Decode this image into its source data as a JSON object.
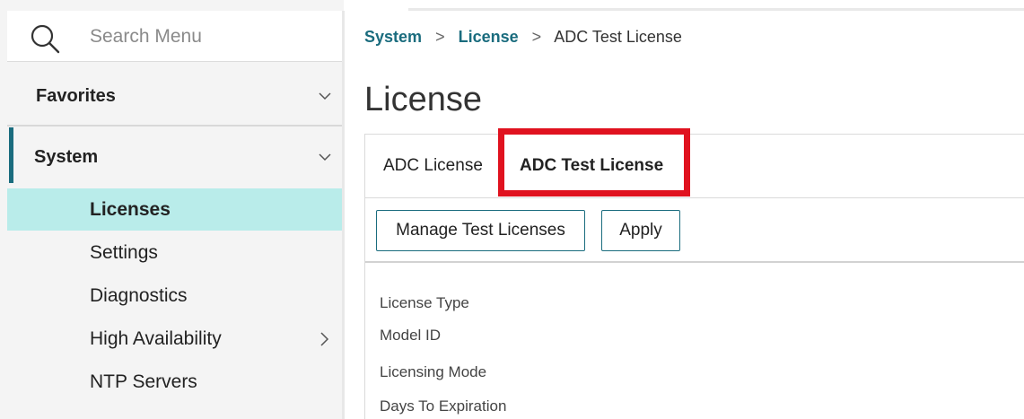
{
  "search": {
    "placeholder": "Search Menu"
  },
  "sidebar": {
    "favorites_label": "Favorites",
    "system_label": "System",
    "items": [
      {
        "label": "Licenses",
        "active": true
      },
      {
        "label": "Settings"
      },
      {
        "label": "Diagnostics"
      },
      {
        "label": "High Availability",
        "has_submenu": true
      },
      {
        "label": "NTP Servers"
      }
    ]
  },
  "breadcrumb": {
    "items": [
      "System",
      "License",
      "ADC Test License"
    ]
  },
  "page": {
    "title": "License"
  },
  "tabs": [
    {
      "label": "ADC License"
    },
    {
      "label": "ADC Test License",
      "selected": true
    }
  ],
  "toolbar": {
    "manage_label": "Manage Test Licenses",
    "apply_label": "Apply"
  },
  "details": {
    "fields": [
      "License Type",
      "Model ID",
      "Licensing Mode",
      "Days To Expiration"
    ]
  },
  "colors": {
    "accent": "#1a6c7e",
    "active_bg": "#b9ecea",
    "highlight": "#e0121f"
  },
  "icons": {
    "search": "search-icon",
    "chevron_down": "chevron-down-icon",
    "chevron_right": "chevron-right-icon"
  }
}
